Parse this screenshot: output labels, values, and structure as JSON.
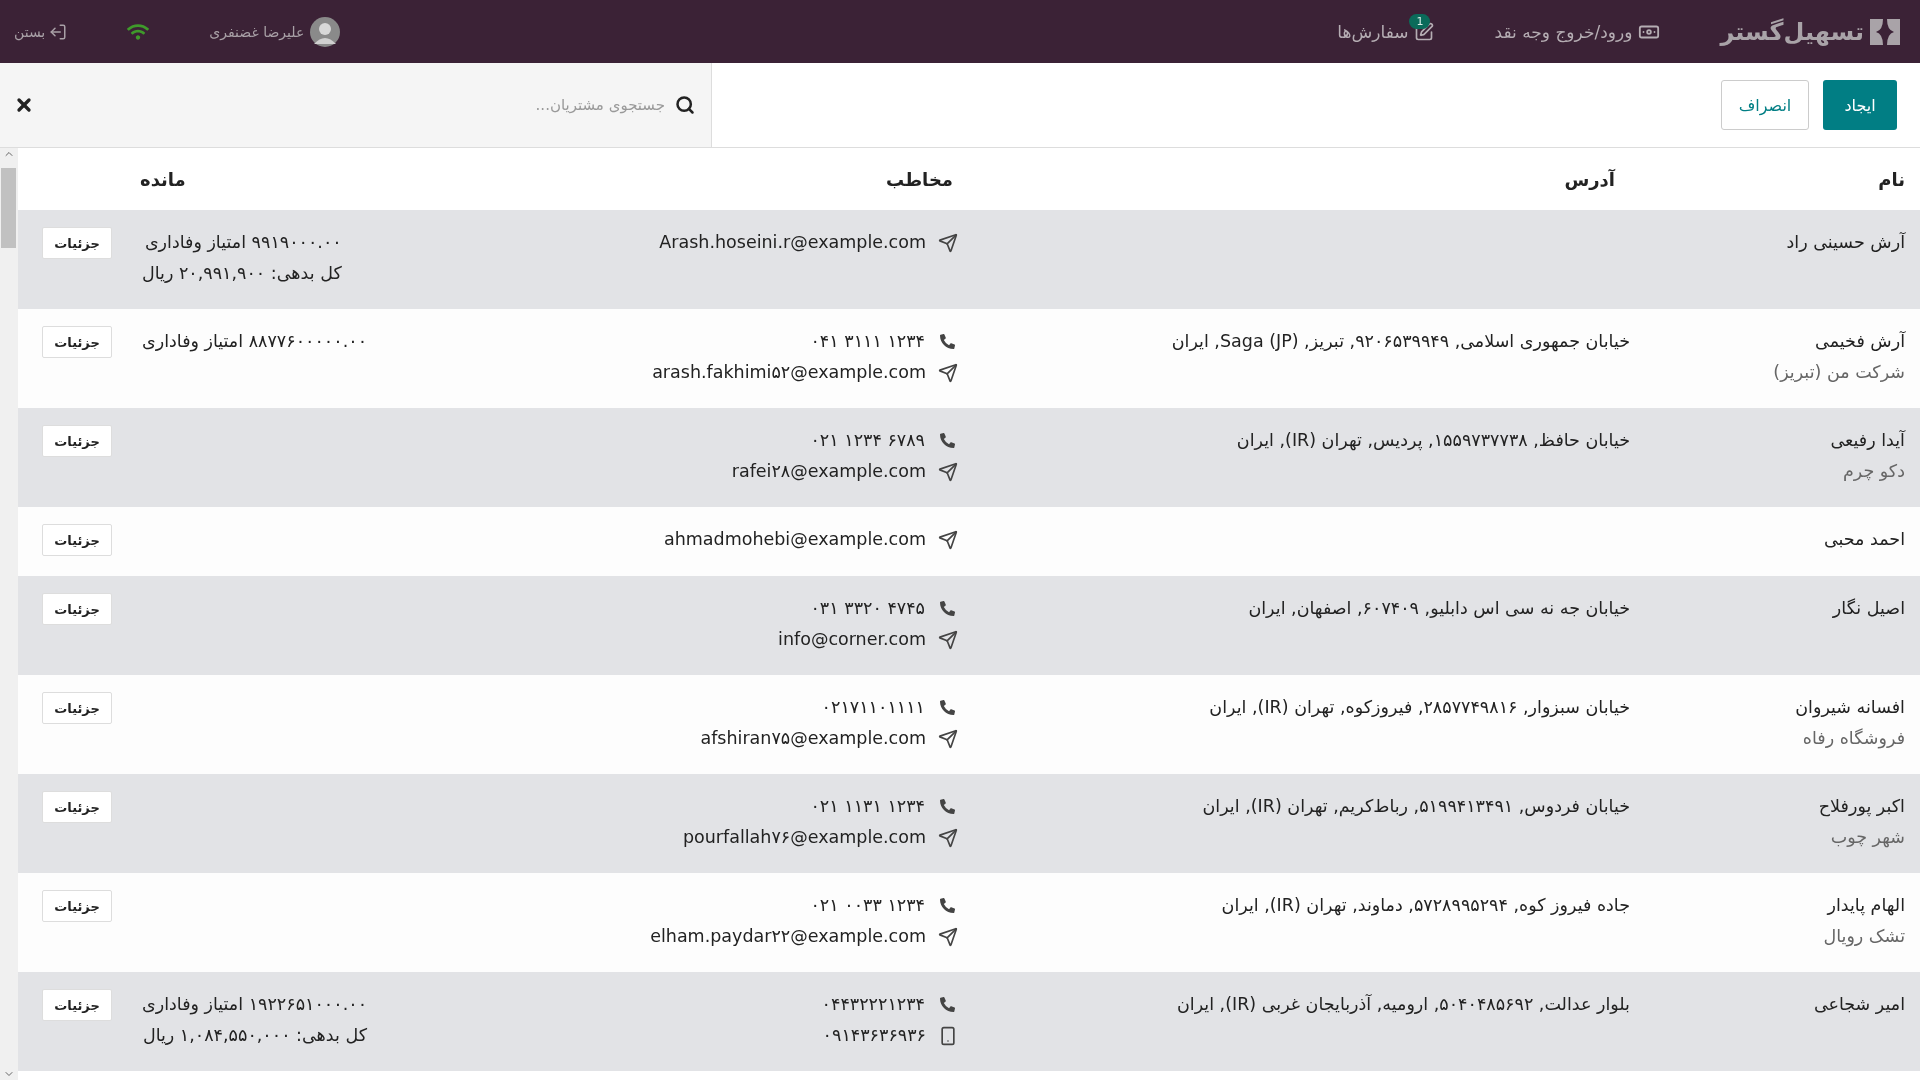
{
  "top_bar": {
    "brand": "تسهیل‌گستر",
    "nav": [
      {
        "kind": "cash",
        "label": "ورود/خروج وجه نقد"
      },
      {
        "kind": "orders",
        "label": "سفارش‌ها",
        "badge": "1"
      }
    ],
    "user": "علیرضا غضنفری",
    "close": "بستن"
  },
  "actions": {
    "create": "ایجاد",
    "cancel": "انصراف"
  },
  "search": {
    "placeholder": "جستجوی مشتریان..."
  },
  "table": {
    "columns": [
      "نام",
      "آدرس",
      "مخاطب",
      "مانده"
    ],
    "rows": [
      {
        "name": "آرش حسینی راد",
        "contacts": [
          {
            "kind": "email",
            "text": "Arash.hoseini.r@example.com"
          }
        ],
        "balance": [
          "۹۹۱۹۰۰۰.۰۰ امتیاز وفاداری",
          "کل بدهی: ۲۰,۹۹۱,۹۰۰ ریال"
        ],
        "details": "جزئیات"
      },
      {
        "name": "آرش فخیمی",
        "company": "شرکت من (تبریز)",
        "address": "خیابان جمهوری اسلامی, ۹۲۰۶۵۳۹۹۴۹, تبریز, Saga (JP), ایران",
        "contacts": [
          {
            "kind": "phone",
            "text": "۰۴۱ ۳۱۱۱ ۱۲۳۴"
          },
          {
            "kind": "email",
            "text": "arash.fakhimi۵۲@example.com"
          }
        ],
        "balance": [
          "۸۸۷۷۶۰۰۰۰۰.۰۰ امتیاز وفاداری"
        ],
        "details": "جزئیات"
      },
      {
        "name": "آیدا رفیعی",
        "company": "دکو چرم",
        "address": "خیابان حافظ, ۱۵۵۹۷۳۷۷۳۸, پردیس, تهران (IR), ایران",
        "contacts": [
          {
            "kind": "phone",
            "text": "۰۲۱ ۱۲۳۴ ۶۷۸۹"
          },
          {
            "kind": "email",
            "text": "rafei۲۸@example.com"
          }
        ],
        "details": "جزئیات"
      },
      {
        "name": "احمد محبی",
        "contacts": [
          {
            "kind": "email",
            "text": "ahmadmohebi@example.com"
          }
        ],
        "details": "جزئیات"
      },
      {
        "name": "اصیل نگار",
        "address": "خیابان جه نه سی اس دابلیو, ۶۰۷۴۰۹, اصفهان, ایران",
        "contacts": [
          {
            "kind": "phone",
            "text": "۰۳۱ ۳۳۲۰ ۴۷۴۵"
          },
          {
            "kind": "email",
            "text": "info@corner.com"
          }
        ],
        "details": "جزئیات"
      },
      {
        "name": "افسانه شیروان",
        "company": "فروشگاه رفاه",
        "address": "خیابان سبزوار, ۲۸۵۷۷۴۹۸۱۶, فیروزکوه, تهران (IR), ایران",
        "contacts": [
          {
            "kind": "phone",
            "text": "۰۲۱۷۱۱۰۱۱۱۱"
          },
          {
            "kind": "email",
            "text": "afshiran۷۵@example.com"
          }
        ],
        "details": "جزئیات"
      },
      {
        "name": "اکبر پورفلاح",
        "company": "شهر چوب",
        "address": "خیابان فردوس, ۵۱۹۹۴۱۳۴۹۱, رباط‌کریم, تهران (IR), ایران",
        "contacts": [
          {
            "kind": "phone",
            "text": "۰۲۱ ۱۱۳۱ ۱۲۳۴"
          },
          {
            "kind": "email",
            "text": "pourfallah۷۶@example.com"
          }
        ],
        "details": "جزئیات"
      },
      {
        "name": "الهام پایدار",
        "company": "تشک رویال",
        "address": "جاده فیروز کوه, ۵۷۲۸۹۹۵۲۹۴, دماوند, تهران (IR), ایران",
        "contacts": [
          {
            "kind": "phone",
            "text": "۰۲۱ ۰۰۳۳ ۱۲۳۴"
          },
          {
            "kind": "email",
            "text": "elham.paydar۲۲@example.com"
          }
        ],
        "details": "جزئیات"
      },
      {
        "name": "امیر شجاعی",
        "address": "بلوار عدالت, ۵۰۴۰۴۸۵۶۹۲, ارومیه, آذربایجان غربی (IR), ایران",
        "contacts": [
          {
            "kind": "phone",
            "text": "۰۴۴۳۲۲۲۱۲۳۴"
          },
          {
            "kind": "mobile",
            "text": "۰۹۱۴۳۶۳۶۹۳۶"
          }
        ],
        "balance": [
          "۱۹۲۲۶۵۱۰۰۰.۰۰ امتیاز وفاداری",
          "کل بدهی: ۱,۰۸۴,۵۵۰,۰۰۰ ریال"
        ],
        "details": "جزئیات"
      }
    ]
  }
}
